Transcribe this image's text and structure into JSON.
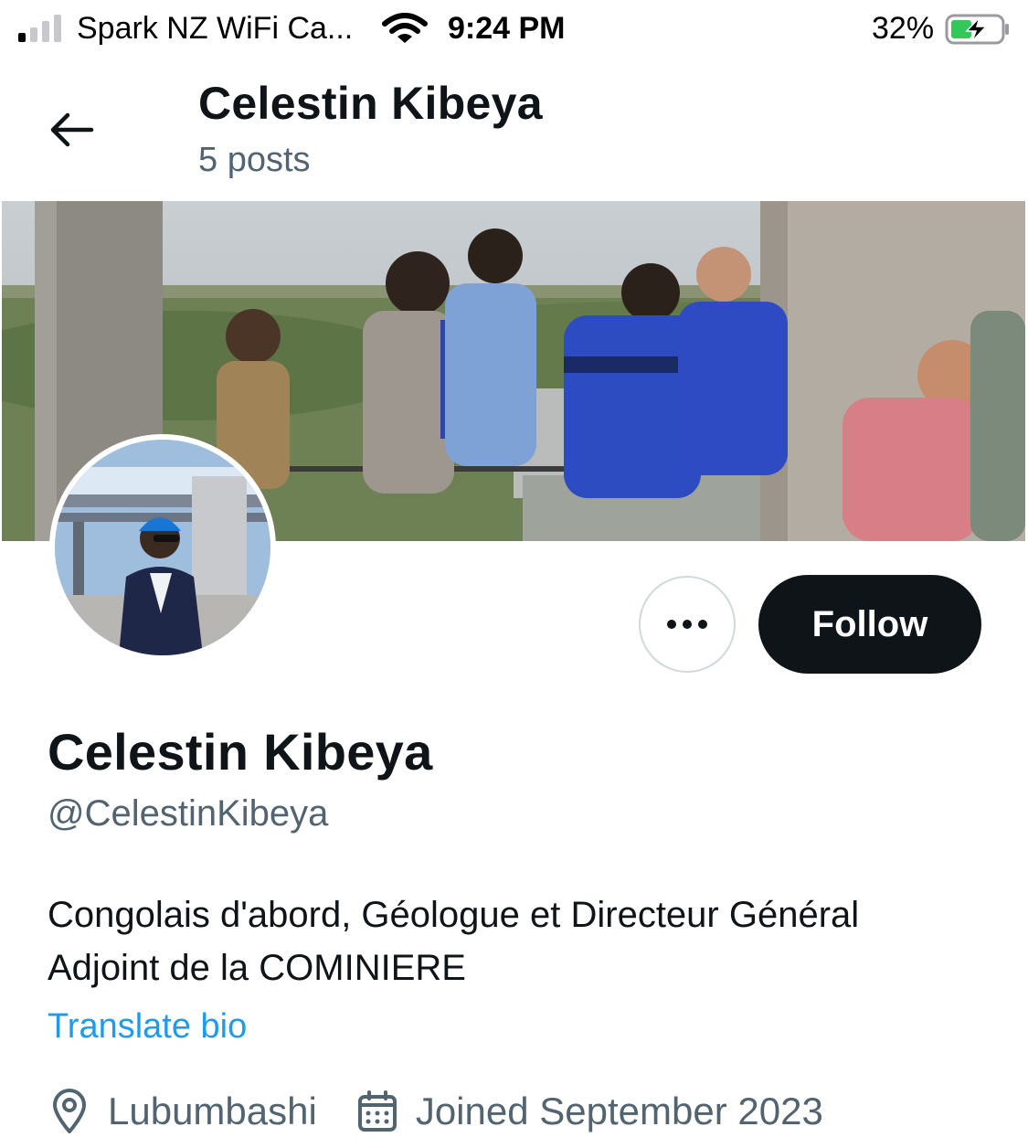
{
  "status_bar": {
    "carrier": "Spark NZ WiFi Ca...",
    "time": "9:24 PM",
    "battery_percent": "32%",
    "signal_bars_active": 1,
    "signal_bars_total": 4
  },
  "header": {
    "name": "Celestin Kibeya",
    "posts": "5 posts",
    "back_icon": "arrow-left-icon"
  },
  "profile": {
    "display_name": "Celestin Kibeya",
    "handle": "@CelestinKibeya",
    "bio_lines": [
      "Congolais d'abord, Géologue et Directeur Général",
      "Adjoint de la COMINIERE"
    ],
    "translate_label": "Translate bio",
    "location": "Lubumbashi",
    "joined": "Joined September 2023"
  },
  "actions": {
    "more_icon": "ellipsis-icon",
    "follow_label": "Follow"
  },
  "colors": {
    "text_primary": "#0f1419",
    "text_secondary": "#536471",
    "link": "#1d9bf0",
    "follow_bg": "#0f1419",
    "battery_green": "#34c759"
  }
}
